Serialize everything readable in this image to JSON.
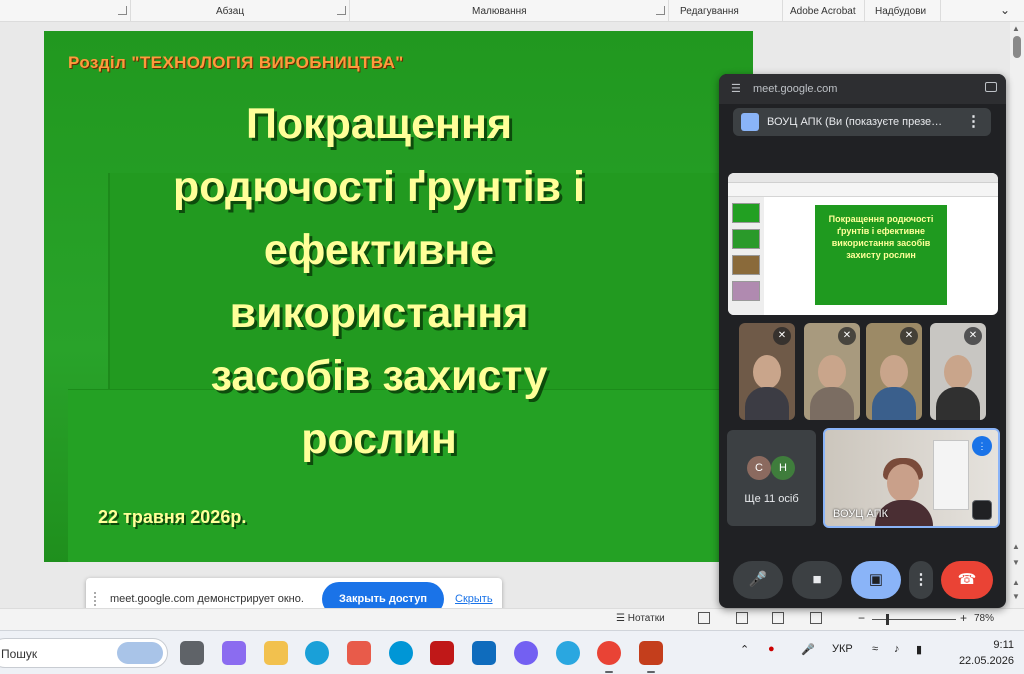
{
  "ribbon": {
    "groups": [
      "Абзац",
      "Малювання",
      "Редагування",
      "Adobe Acrobat",
      "Надбудови"
    ]
  },
  "slide": {
    "section": "Розділ  \"ТЕХНОЛОГІЯ  ВИРОБНИЦТВА\"",
    "title_lines": [
      "Покращення",
      "родючості ґрунтів і",
      "ефективне",
      "використання",
      "засобів захисту",
      "рослин"
    ],
    "date": "22 травня 2026р."
  },
  "share_notice": {
    "message": "meet.google.com демонстрирует окно.",
    "stop_button": "Закрыть доступ",
    "hide_link": "Скрыть"
  },
  "statusbar": {
    "notes": "Нотатки",
    "zoom": "78%",
    "zoom_value_percent": 78
  },
  "meet": {
    "url": "meet.google.com",
    "presenter_strip": "ВОУЦ АПК (Ви (показуєте презе…",
    "preview_title": "Покращення родючості ґрунтів і ефективне використання засобів захисту рослин",
    "others_initials": [
      "С",
      "Н"
    ],
    "others_count": "Ще 11 осіб",
    "self_name": "ВОУЦ АПК",
    "colors": {
      "panel": "#202124",
      "share_active": "#8ab4f8",
      "end_call": "#ea4335"
    }
  },
  "taskbar": {
    "search": "Пошук",
    "language": "УКР",
    "time": "9:11",
    "date": "22.05.2026",
    "apps": [
      "task-view-icon",
      "copilot-icon",
      "file-explorer-icon",
      "edge-icon",
      "store-icon",
      "hp-icon",
      "mcafee-icon",
      "mail-icon",
      "viber-icon",
      "help-icon",
      "chrome-icon",
      "powerpoint-icon"
    ]
  }
}
